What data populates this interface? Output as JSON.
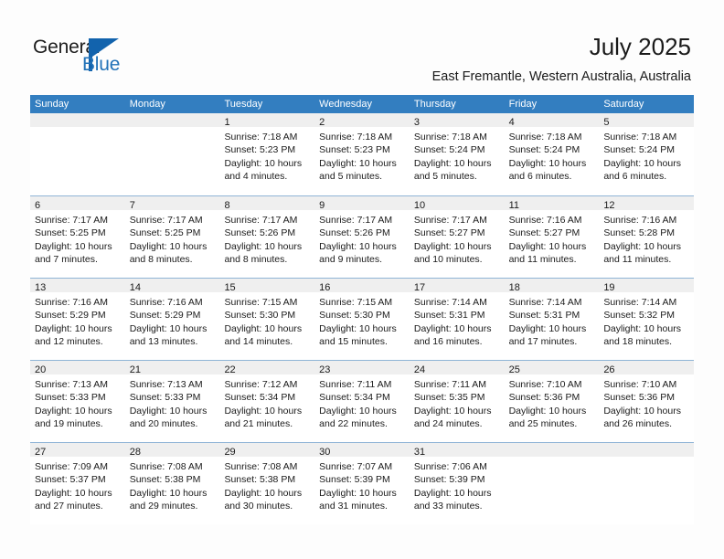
{
  "brand": {
    "name_part1": "General",
    "name_part2": "Blue",
    "logo_icon": "triangle-logo-mark",
    "accent_color": "#1263ad"
  },
  "header": {
    "title": "July 2025",
    "subtitle": "East Fremantle, Western Australia, Australia"
  },
  "theme": {
    "header_row_color": "#337ec0",
    "daynum_strip_color": "#efefef",
    "row_separator_color": "#8fb4d6",
    "text_color": "#1a1a1a",
    "page_background": "#fdfdfd"
  },
  "weekdays": [
    "Sunday",
    "Monday",
    "Tuesday",
    "Wednesday",
    "Thursday",
    "Friday",
    "Saturday"
  ],
  "weeks": [
    [
      {
        "day": "",
        "blank": true,
        "lines": []
      },
      {
        "day": "",
        "blank": true,
        "lines": []
      },
      {
        "day": "1",
        "blank": false,
        "lines": [
          "Sunrise: 7:18 AM",
          "Sunset: 5:23 PM",
          "Daylight: 10 hours and 4 minutes."
        ]
      },
      {
        "day": "2",
        "blank": false,
        "lines": [
          "Sunrise: 7:18 AM",
          "Sunset: 5:23 PM",
          "Daylight: 10 hours and 5 minutes."
        ]
      },
      {
        "day": "3",
        "blank": false,
        "lines": [
          "Sunrise: 7:18 AM",
          "Sunset: 5:24 PM",
          "Daylight: 10 hours and 5 minutes."
        ]
      },
      {
        "day": "4",
        "blank": false,
        "lines": [
          "Sunrise: 7:18 AM",
          "Sunset: 5:24 PM",
          "Daylight: 10 hours and 6 minutes."
        ]
      },
      {
        "day": "5",
        "blank": false,
        "lines": [
          "Sunrise: 7:18 AM",
          "Sunset: 5:24 PM",
          "Daylight: 10 hours and 6 minutes."
        ]
      }
    ],
    [
      {
        "day": "6",
        "blank": false,
        "lines": [
          "Sunrise: 7:17 AM",
          "Sunset: 5:25 PM",
          "Daylight: 10 hours and 7 minutes."
        ]
      },
      {
        "day": "7",
        "blank": false,
        "lines": [
          "Sunrise: 7:17 AM",
          "Sunset: 5:25 PM",
          "Daylight: 10 hours and 8 minutes."
        ]
      },
      {
        "day": "8",
        "blank": false,
        "lines": [
          "Sunrise: 7:17 AM",
          "Sunset: 5:26 PM",
          "Daylight: 10 hours and 8 minutes."
        ]
      },
      {
        "day": "9",
        "blank": false,
        "lines": [
          "Sunrise: 7:17 AM",
          "Sunset: 5:26 PM",
          "Daylight: 10 hours and 9 minutes."
        ]
      },
      {
        "day": "10",
        "blank": false,
        "lines": [
          "Sunrise: 7:17 AM",
          "Sunset: 5:27 PM",
          "Daylight: 10 hours and 10 minutes."
        ]
      },
      {
        "day": "11",
        "blank": false,
        "lines": [
          "Sunrise: 7:16 AM",
          "Sunset: 5:27 PM",
          "Daylight: 10 hours and 11 minutes."
        ]
      },
      {
        "day": "12",
        "blank": false,
        "lines": [
          "Sunrise: 7:16 AM",
          "Sunset: 5:28 PM",
          "Daylight: 10 hours and 11 minutes."
        ]
      }
    ],
    [
      {
        "day": "13",
        "blank": false,
        "lines": [
          "Sunrise: 7:16 AM",
          "Sunset: 5:29 PM",
          "Daylight: 10 hours and 12 minutes."
        ]
      },
      {
        "day": "14",
        "blank": false,
        "lines": [
          "Sunrise: 7:16 AM",
          "Sunset: 5:29 PM",
          "Daylight: 10 hours and 13 minutes."
        ]
      },
      {
        "day": "15",
        "blank": false,
        "lines": [
          "Sunrise: 7:15 AM",
          "Sunset: 5:30 PM",
          "Daylight: 10 hours and 14 minutes."
        ]
      },
      {
        "day": "16",
        "blank": false,
        "lines": [
          "Sunrise: 7:15 AM",
          "Sunset: 5:30 PM",
          "Daylight: 10 hours and 15 minutes."
        ]
      },
      {
        "day": "17",
        "blank": false,
        "lines": [
          "Sunrise: 7:14 AM",
          "Sunset: 5:31 PM",
          "Daylight: 10 hours and 16 minutes."
        ]
      },
      {
        "day": "18",
        "blank": false,
        "lines": [
          "Sunrise: 7:14 AM",
          "Sunset: 5:31 PM",
          "Daylight: 10 hours and 17 minutes."
        ]
      },
      {
        "day": "19",
        "blank": false,
        "lines": [
          "Sunrise: 7:14 AM",
          "Sunset: 5:32 PM",
          "Daylight: 10 hours and 18 minutes."
        ]
      }
    ],
    [
      {
        "day": "20",
        "blank": false,
        "lines": [
          "Sunrise: 7:13 AM",
          "Sunset: 5:33 PM",
          "Daylight: 10 hours and 19 minutes."
        ]
      },
      {
        "day": "21",
        "blank": false,
        "lines": [
          "Sunrise: 7:13 AM",
          "Sunset: 5:33 PM",
          "Daylight: 10 hours and 20 minutes."
        ]
      },
      {
        "day": "22",
        "blank": false,
        "lines": [
          "Sunrise: 7:12 AM",
          "Sunset: 5:34 PM",
          "Daylight: 10 hours and 21 minutes."
        ]
      },
      {
        "day": "23",
        "blank": false,
        "lines": [
          "Sunrise: 7:11 AM",
          "Sunset: 5:34 PM",
          "Daylight: 10 hours and 22 minutes."
        ]
      },
      {
        "day": "24",
        "blank": false,
        "lines": [
          "Sunrise: 7:11 AM",
          "Sunset: 5:35 PM",
          "Daylight: 10 hours and 24 minutes."
        ]
      },
      {
        "day": "25",
        "blank": false,
        "lines": [
          "Sunrise: 7:10 AM",
          "Sunset: 5:36 PM",
          "Daylight: 10 hours and 25 minutes."
        ]
      },
      {
        "day": "26",
        "blank": false,
        "lines": [
          "Sunrise: 7:10 AM",
          "Sunset: 5:36 PM",
          "Daylight: 10 hours and 26 minutes."
        ]
      }
    ],
    [
      {
        "day": "27",
        "blank": false,
        "lines": [
          "Sunrise: 7:09 AM",
          "Sunset: 5:37 PM",
          "Daylight: 10 hours and 27 minutes."
        ]
      },
      {
        "day": "28",
        "blank": false,
        "lines": [
          "Sunrise: 7:08 AM",
          "Sunset: 5:38 PM",
          "Daylight: 10 hours and 29 minutes."
        ]
      },
      {
        "day": "29",
        "blank": false,
        "lines": [
          "Sunrise: 7:08 AM",
          "Sunset: 5:38 PM",
          "Daylight: 10 hours and 30 minutes."
        ]
      },
      {
        "day": "30",
        "blank": false,
        "lines": [
          "Sunrise: 7:07 AM",
          "Sunset: 5:39 PM",
          "Daylight: 10 hours and 31 minutes."
        ]
      },
      {
        "day": "31",
        "blank": false,
        "lines": [
          "Sunrise: 7:06 AM",
          "Sunset: 5:39 PM",
          "Daylight: 10 hours and 33 minutes."
        ]
      },
      {
        "day": "",
        "blank": true,
        "lines": []
      },
      {
        "day": "",
        "blank": true,
        "lines": []
      }
    ]
  ]
}
